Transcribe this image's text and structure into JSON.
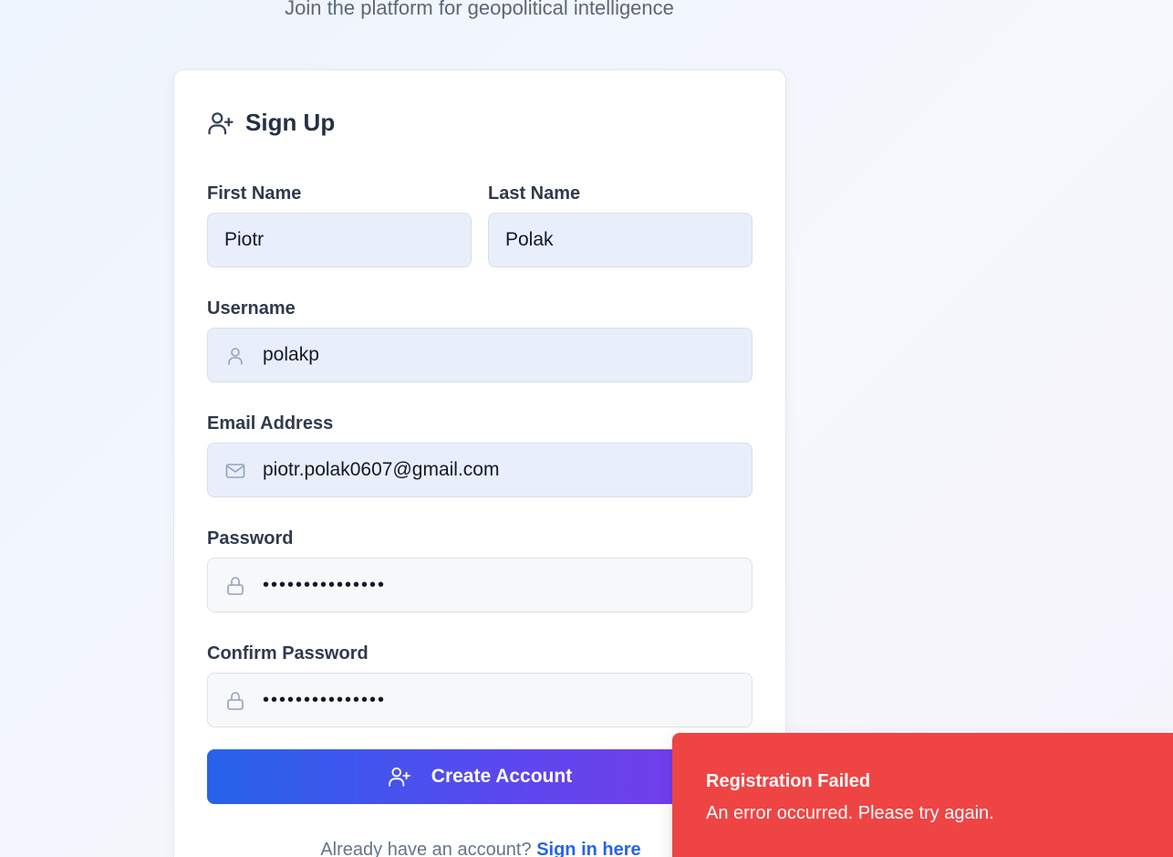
{
  "header": {
    "subtitle": "Join the platform for geopolitical intelligence"
  },
  "form": {
    "title": "Sign Up",
    "title_icon": "user-plus-icon",
    "first_name": {
      "label": "First Name",
      "value": "Piotr"
    },
    "last_name": {
      "label": "Last Name",
      "value": "Polak"
    },
    "username": {
      "label": "Username",
      "value": "polakp",
      "icon": "user-icon"
    },
    "email": {
      "label": "Email Address",
      "value": "piotr.polak0607@gmail.com",
      "icon": "mail-icon"
    },
    "password": {
      "label": "Password",
      "value": "passwordpasswor",
      "icon": "lock-icon"
    },
    "confirm_password": {
      "label": "Confirm Password",
      "value": "passwordpasswor",
      "icon": "lock-icon"
    },
    "submit": {
      "label": "Create Account",
      "icon": "user-plus-icon"
    },
    "footer": {
      "prompt": "Already have an account?",
      "link": "Sign in here"
    }
  },
  "toast": {
    "title": "Registration Failed",
    "message": "An error occurred. Please try again."
  },
  "colors": {
    "accent": "#2563eb",
    "accent_end": "#7c3aed",
    "error": "#ef4444",
    "input_filled": "#e8effb"
  }
}
